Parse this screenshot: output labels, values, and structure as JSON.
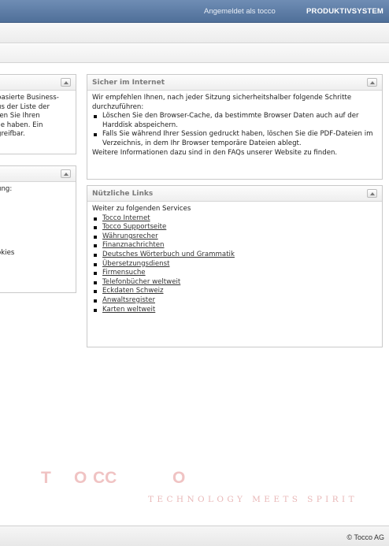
{
  "topbar": {
    "logged_in_text": "Angemeldet als tocco",
    "system_label": "PRODUKTIVSYSTEM",
    "background": "#5a7aa5"
  },
  "left_panels": [
    {
      "lines": [
        "basierte Business-",
        "us der Liste der",
        "ren Sie Ihren",
        "ile haben. Ein",
        "greifbar."
      ]
    },
    {
      "lines": [
        "ung:",
        "",
        "",
        "",
        "",
        "",
        "",
        "okies"
      ]
    }
  ],
  "security_panel": {
    "title": "Sicher im Internet",
    "intro": "Wir empfehlen Ihnen, nach jeder Sitzung sicherheitshalber folgende Schritte durchzuführen:",
    "items": [
      "Löschen Sie den Browser-Cache, da bestimmte Browser Daten auch auf der Harddisk abspeichern.",
      "Falls Sie während Ihrer Session gedruckt haben, löschen Sie die PDF-Dateien im Verzeichnis, in dem Ihr Browser temporäre Dateien ablegt."
    ],
    "outro": "Weitere Informationen dazu sind in den FAQs unserer Website zu finden."
  },
  "links_panel": {
    "title": "Nützliche Links",
    "intro": "Weiter zu folgenden Services",
    "links": [
      "Tocco Internet",
      "Tocco Supportseite",
      "Währungsrecher",
      "Finanznachrichten",
      "Deutsches Wörterbuch und Grammatik",
      "Übersetzungsdienst",
      "Firmensuche",
      "Telefonbücher weltweit",
      "Eckdaten Schweiz",
      "Anwaltsregister",
      "Karten weltweit"
    ]
  },
  "logo": {
    "letters": [
      "T",
      "O",
      "CC",
      "O"
    ],
    "tagline": "TECHNOLOGY MEETS SPIRIT",
    "color": "#f0c3c3"
  },
  "footer": {
    "copyright": "© Tocco AG"
  }
}
